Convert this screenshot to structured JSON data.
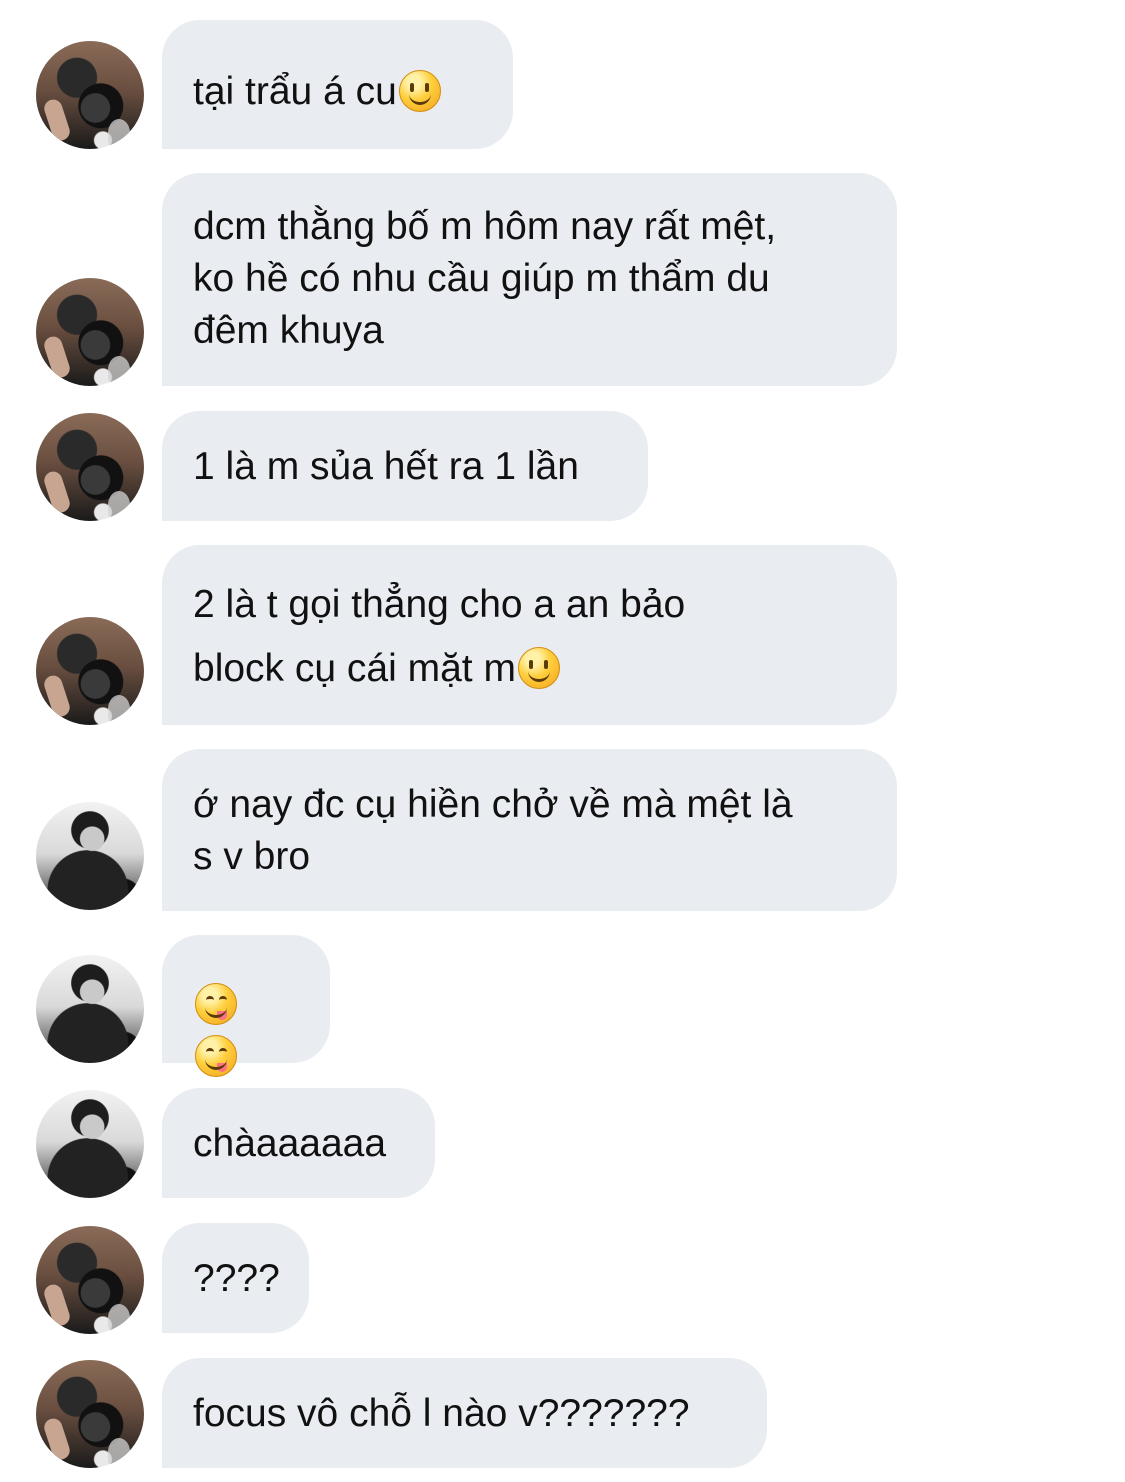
{
  "messages": [
    {
      "avatar": "avatar-camera",
      "lines": [
        "tại trẩu á cu"
      ],
      "emoji_after_last_line": [
        "slightly-smiling-face"
      ]
    },
    {
      "avatar": "avatar-camera",
      "lines": [
        "dcm thằng bố m hôm nay rất mệt,",
        "ko hề có nhu cầu giúp m thẩm du",
        "đêm khuya"
      ],
      "emoji_after_last_line": []
    },
    {
      "avatar": "avatar-camera",
      "lines": [
        "1 là m sủa hết ra 1 lần"
      ],
      "emoji_after_last_line": []
    },
    {
      "avatar": "avatar-camera",
      "lines": [
        "2 là t gọi thẳng cho a an bảo",
        "block cụ cái mặt m"
      ],
      "emoji_after_last_line": [
        "slightly-smiling-face"
      ]
    },
    {
      "avatar": "avatar-portrait",
      "lines": [
        "ớ nay đc cụ hiền chở về mà mệt là",
        "s v bro"
      ],
      "emoji_after_last_line": []
    },
    {
      "avatar": "avatar-portrait",
      "lines": [
        ""
      ],
      "emoji_after_last_line": [
        "face-savoring-food",
        "face-savoring-food"
      ]
    },
    {
      "avatar": "avatar-portrait",
      "lines": [
        "chàaaaaaa"
      ],
      "emoji_after_last_line": []
    },
    {
      "avatar": "avatar-camera",
      "lines": [
        "????"
      ],
      "emoji_after_last_line": []
    },
    {
      "avatar": "avatar-camera",
      "lines": [
        "focus vô chỗ l nào v???????"
      ],
      "emoji_after_last_line": []
    }
  ],
  "colors": {
    "bubble": "#e9ecf0",
    "text": "#111111",
    "background": "#ffffff"
  }
}
